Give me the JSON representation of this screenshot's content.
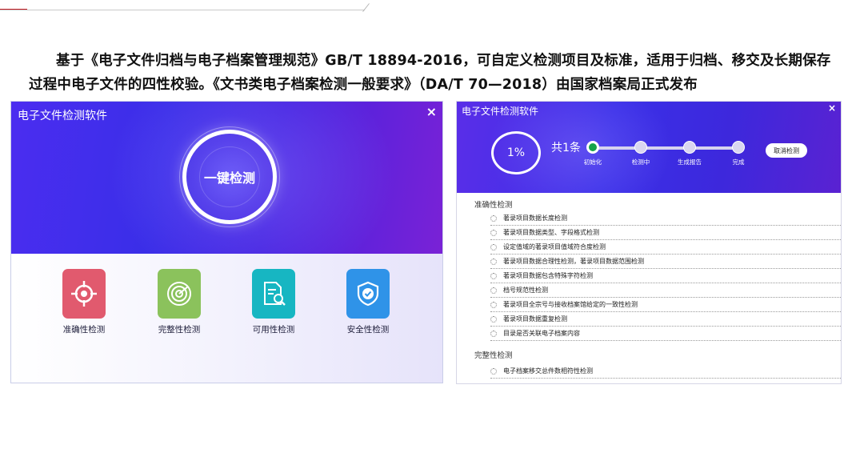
{
  "description": {
    "line1": "基于《电子文件归档与电子档案管理规范》GB/T 18894-2016，可自定义检测项目及标准，适用于归档、移交及长期保存",
    "line2": "过程中电子文件的四性校验。《文书类电子档案检测一般要求》（DA/T 70—2018）由国家档案局正式发布"
  },
  "left_window": {
    "title": "电子文件检测软件",
    "close": "×",
    "main_button": "一键检测",
    "tiles": [
      {
        "label": "准确性检测",
        "icon": "crosshair-icon",
        "color": "#e15a6e"
      },
      {
        "label": "完整性检测",
        "icon": "radar-icon",
        "color": "#8bc25c"
      },
      {
        "label": "可用性检测",
        "icon": "document-search-icon",
        "color": "#17b6c2"
      },
      {
        "label": "安全性检测",
        "icon": "shield-check-icon",
        "color": "#2f93e8"
      }
    ]
  },
  "right_window": {
    "title": "电子文件检测软件",
    "close": "×",
    "progress": "1%",
    "count": "共1条",
    "steps": [
      "初始化",
      "检测中",
      "生成报告",
      "完成"
    ],
    "active_step": 0,
    "cancel_button": "取消检测",
    "sections": [
      {
        "title": "准确性检测",
        "items": [
          "著录项目数据长度检测",
          "著录项目数据类型、字段格式检测",
          "设定值域的著录项目值域符合度检测",
          "著录项目数据合理性检测，著录项目数据范围检测",
          "著录项目数据包含特殊字符检测",
          "档号规范性检测",
          "著录项目全宗号与接收档案馆给定的一致性检测",
          "著录项目数据重复检测",
          "目录是否关联电子档案内容"
        ]
      },
      {
        "title": "完整性检测",
        "items": [
          "电子档案移交总件数相符性检测"
        ]
      }
    ]
  },
  "colors": {
    "accent_red": "#c0171e",
    "header_blue": "#3a2ee8",
    "progress_green": "#16a34a"
  }
}
